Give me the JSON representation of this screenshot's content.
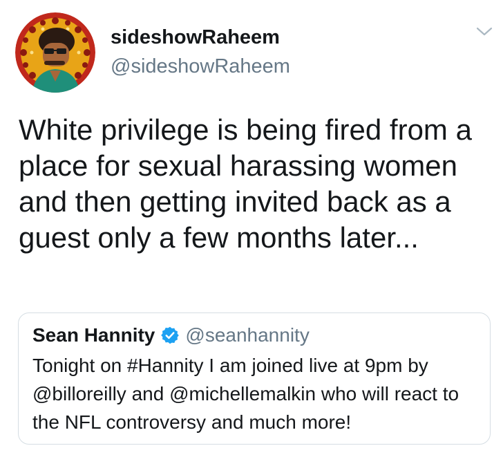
{
  "tweet": {
    "display_name": "sideshowRaheem",
    "handle": "@sideshowRaheem",
    "text": "White privilege is being fired from a place for sexual harassing women and then getting invited back as a guest only a few months later...",
    "avatar_icon": "cartoon-avatar-icon",
    "menu_icon": "chevron-down-icon"
  },
  "quoted_tweet": {
    "display_name": "Sean Hannity",
    "handle": "@seanhannity",
    "verified_icon": "verified-badge-icon",
    "text": "Tonight on #Hannity I am joined live at 9pm by @billoreilly and @michellemalkin who will react to the NFL controversy and much more!"
  },
  "colors": {
    "text_primary": "#14171a",
    "text_secondary": "#657786",
    "verified_blue": "#1da1f2",
    "quote_border": "#d5dde3"
  }
}
